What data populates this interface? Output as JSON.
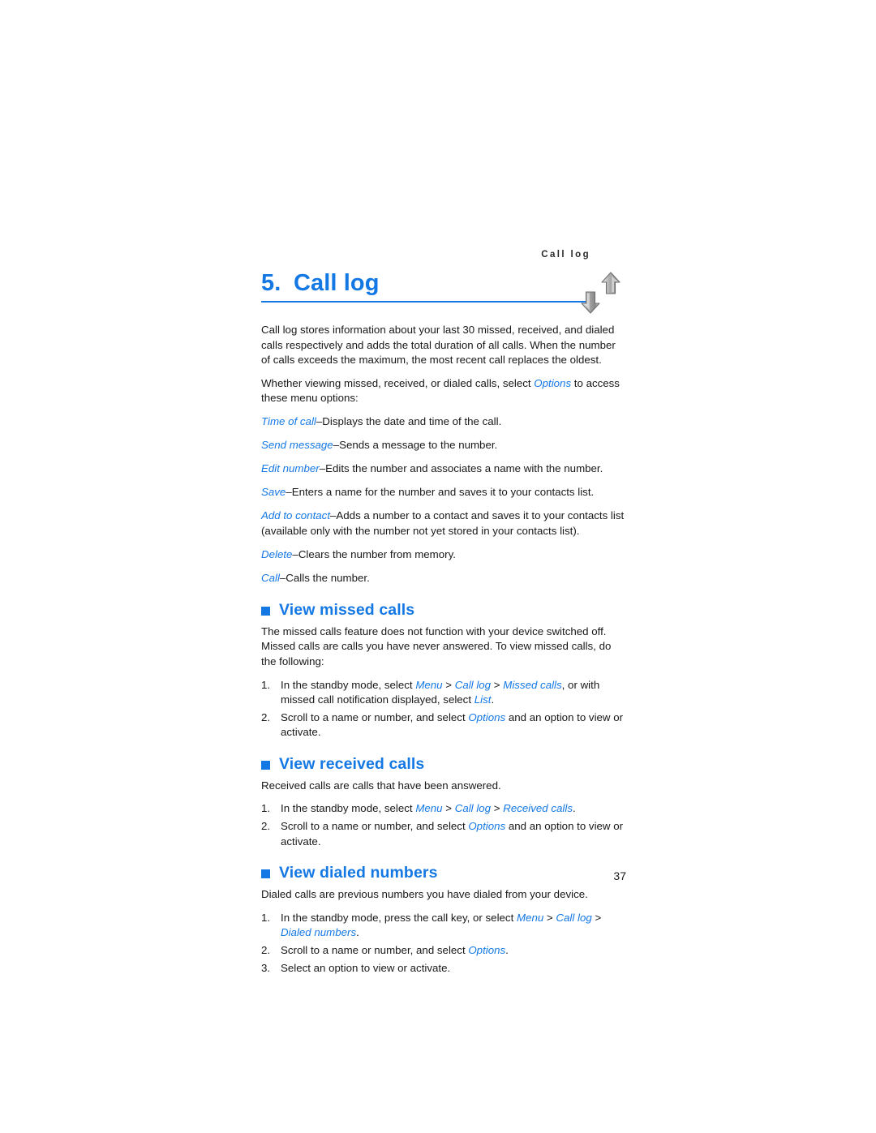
{
  "header": {
    "running_title": "Call log",
    "page_number": "37"
  },
  "chapter": {
    "number": "5.",
    "title": "Call log",
    "icon": "up-down-arrows-icon"
  },
  "intro": {
    "paragraph_1": "Call log stores information about your last 30 missed, received, and dialed calls respectively and adds the total duration of all calls. When the number of calls exceeds the maximum, the most recent call replaces the oldest.",
    "paragraph_2_a": "Whether viewing missed, received, or dialed calls, select ",
    "paragraph_2_term": "Options",
    "paragraph_2_b": " to access these menu options:"
  },
  "options": [
    {
      "term": "Time of call",
      "description": "–Displays the date and time of the call."
    },
    {
      "term": "Send message",
      "description": "–Sends a message to the number."
    },
    {
      "term": "Edit number",
      "description": "–Edits the number and associates a name with the number."
    },
    {
      "term": "Save",
      "description": "–Enters a name for the number and saves it to your contacts list."
    },
    {
      "term": "Add to contact",
      "description": "–Adds a number to a contact and saves it to your contacts list (available only with the number not yet stored in your contacts list)."
    },
    {
      "term": "Delete",
      "description": "–Clears the number from memory."
    },
    {
      "term": "Call",
      "description": "–Calls the number."
    }
  ],
  "sections": [
    {
      "heading": "View missed calls",
      "intro": "The missed calls feature does not function with your device switched off. Missed calls are calls you have never answered. To view missed calls, do the following:",
      "steps": [
        {
          "marker": "1.",
          "parts": [
            {
              "text": "In the standby mode, select ",
              "style": "plain"
            },
            {
              "text": "Menu",
              "style": "term"
            },
            {
              "text": " > ",
              "style": "plain"
            },
            {
              "text": "Call log",
              "style": "term"
            },
            {
              "text": " > ",
              "style": "plain"
            },
            {
              "text": "Missed calls",
              "style": "term"
            },
            {
              "text": ", or with missed call notification displayed, select ",
              "style": "plain"
            },
            {
              "text": "List",
              "style": "term"
            },
            {
              "text": ".",
              "style": "plain"
            }
          ]
        },
        {
          "marker": "2.",
          "parts": [
            {
              "text": "Scroll to a name or number, and select ",
              "style": "plain"
            },
            {
              "text": "Options",
              "style": "term"
            },
            {
              "text": " and an option to view or activate.",
              "style": "plain"
            }
          ]
        }
      ]
    },
    {
      "heading": "View received calls",
      "intro": "Received calls are calls that have been answered.",
      "steps": [
        {
          "marker": "1.",
          "parts": [
            {
              "text": "In the standby mode, select ",
              "style": "plain"
            },
            {
              "text": "Menu",
              "style": "term"
            },
            {
              "text": " > ",
              "style": "plain"
            },
            {
              "text": "Call log",
              "style": "term"
            },
            {
              "text": " > ",
              "style": "plain"
            },
            {
              "text": "Received calls",
              "style": "term"
            },
            {
              "text": ".",
              "style": "plain"
            }
          ]
        },
        {
          "marker": "2.",
          "parts": [
            {
              "text": "Scroll to a name or number, and select ",
              "style": "plain"
            },
            {
              "text": "Options",
              "style": "term"
            },
            {
              "text": " and an option to view or activate.",
              "style": "plain"
            }
          ]
        }
      ]
    },
    {
      "heading": "View dialed numbers",
      "intro": "Dialed calls are previous numbers you have dialed from your device.",
      "steps": [
        {
          "marker": "1.",
          "parts": [
            {
              "text": "In the standby mode, press the call key, or select ",
              "style": "plain"
            },
            {
              "text": "Menu",
              "style": "term"
            },
            {
              "text": " > ",
              "style": "plain"
            },
            {
              "text": "Call log",
              "style": "term"
            },
            {
              "text": " > ",
              "style": "plain"
            },
            {
              "text": "Dialed numbers",
              "style": "term"
            },
            {
              "text": ".",
              "style": "plain"
            }
          ]
        },
        {
          "marker": "2.",
          "parts": [
            {
              "text": "Scroll to a name or number, and select ",
              "style": "plain"
            },
            {
              "text": "Options",
              "style": "term"
            },
            {
              "text": ".",
              "style": "plain"
            }
          ]
        },
        {
          "marker": "3.",
          "parts": [
            {
              "text": "Select an option to view or activate.",
              "style": "plain"
            }
          ]
        }
      ]
    }
  ],
  "colors": {
    "accent_blue": "#1478e4",
    "body_text": "#181818"
  }
}
